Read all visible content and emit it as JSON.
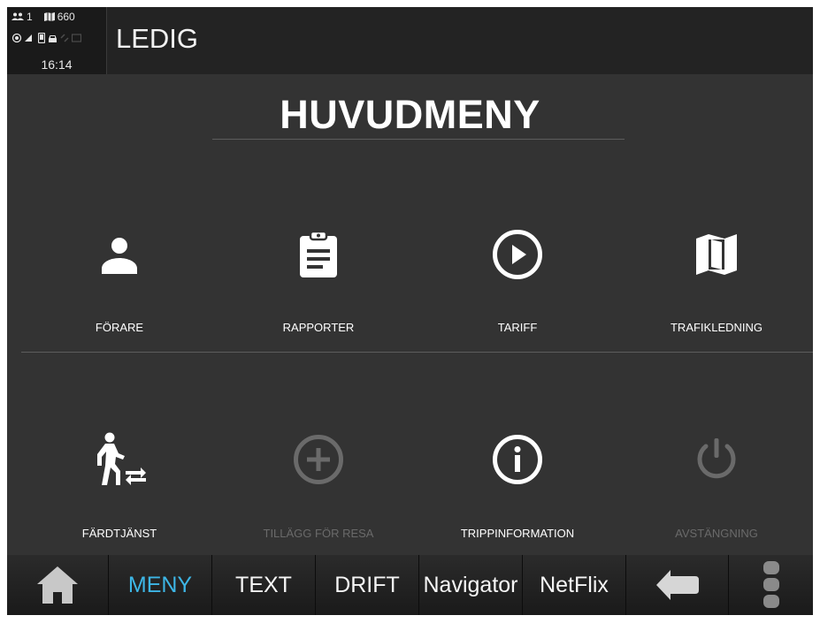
{
  "status": {
    "passengers": "1",
    "map_count": "660",
    "time": "16:14",
    "title": "LEDIG"
  },
  "heading": "HUVUDMENY",
  "menu": [
    {
      "label": "FÖRARE",
      "icon": "person-icon",
      "enabled": true
    },
    {
      "label": "RAPPORTER",
      "icon": "clipboard-icon",
      "enabled": true
    },
    {
      "label": "TARIFF",
      "icon": "play-circle-icon",
      "enabled": true
    },
    {
      "label": "TRAFIKLEDNING",
      "icon": "map-icon",
      "enabled": true
    },
    {
      "label": "FÄRDTJÄNST",
      "icon": "walking-transfer-icon",
      "enabled": true
    },
    {
      "label": "TILLÄGG FÖR RESA",
      "icon": "add-circle-icon",
      "enabled": false
    },
    {
      "label": "TRIPPINFORMATION",
      "icon": "info-circle-icon",
      "enabled": true
    },
    {
      "label": "AVSTÄNGNING",
      "icon": "power-icon",
      "enabled": false
    }
  ],
  "bottom_nav": {
    "home_icon": "home-icon",
    "tabs": [
      "MENY",
      "TEXT",
      "DRIFT",
      "Navigator",
      "NetFlix"
    ],
    "active_tab": "MENY",
    "back_icon": "back-arrow-icon",
    "more_icon": "more-vertical-icon"
  },
  "colors": {
    "background": "#333333",
    "active_tab": "#3db6e6",
    "disabled": "#6a6a6a"
  }
}
